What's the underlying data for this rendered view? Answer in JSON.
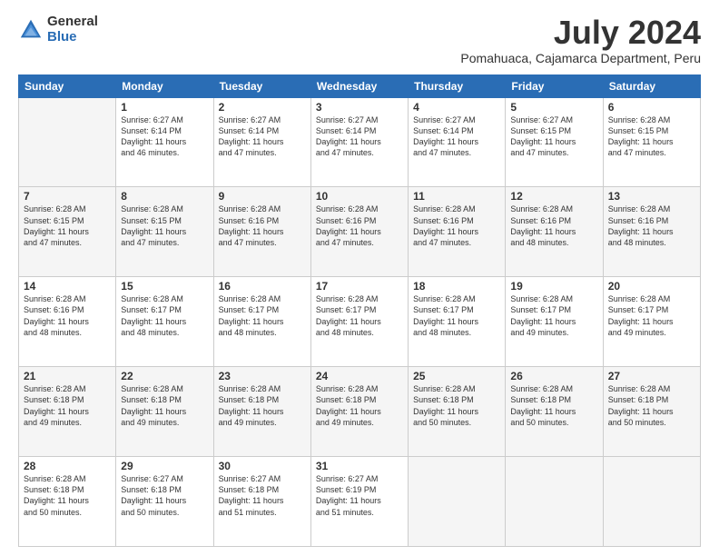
{
  "header": {
    "logo_general": "General",
    "logo_blue": "Blue",
    "month_title": "July 2024",
    "location": "Pomahuaca, Cajamarca Department, Peru"
  },
  "weekdays": [
    "Sunday",
    "Monday",
    "Tuesday",
    "Wednesday",
    "Thursday",
    "Friday",
    "Saturday"
  ],
  "weeks": [
    [
      {
        "day": "",
        "info": ""
      },
      {
        "day": "1",
        "info": "Sunrise: 6:27 AM\nSunset: 6:14 PM\nDaylight: 11 hours\nand 46 minutes."
      },
      {
        "day": "2",
        "info": "Sunrise: 6:27 AM\nSunset: 6:14 PM\nDaylight: 11 hours\nand 47 minutes."
      },
      {
        "day": "3",
        "info": "Sunrise: 6:27 AM\nSunset: 6:14 PM\nDaylight: 11 hours\nand 47 minutes."
      },
      {
        "day": "4",
        "info": "Sunrise: 6:27 AM\nSunset: 6:14 PM\nDaylight: 11 hours\nand 47 minutes."
      },
      {
        "day": "5",
        "info": "Sunrise: 6:27 AM\nSunset: 6:15 PM\nDaylight: 11 hours\nand 47 minutes."
      },
      {
        "day": "6",
        "info": "Sunrise: 6:28 AM\nSunset: 6:15 PM\nDaylight: 11 hours\nand 47 minutes."
      }
    ],
    [
      {
        "day": "7",
        "info": "Sunrise: 6:28 AM\nSunset: 6:15 PM\nDaylight: 11 hours\nand 47 minutes."
      },
      {
        "day": "8",
        "info": "Sunrise: 6:28 AM\nSunset: 6:15 PM\nDaylight: 11 hours\nand 47 minutes."
      },
      {
        "day": "9",
        "info": "Sunrise: 6:28 AM\nSunset: 6:16 PM\nDaylight: 11 hours\nand 47 minutes."
      },
      {
        "day": "10",
        "info": "Sunrise: 6:28 AM\nSunset: 6:16 PM\nDaylight: 11 hours\nand 47 minutes."
      },
      {
        "day": "11",
        "info": "Sunrise: 6:28 AM\nSunset: 6:16 PM\nDaylight: 11 hours\nand 47 minutes."
      },
      {
        "day": "12",
        "info": "Sunrise: 6:28 AM\nSunset: 6:16 PM\nDaylight: 11 hours\nand 48 minutes."
      },
      {
        "day": "13",
        "info": "Sunrise: 6:28 AM\nSunset: 6:16 PM\nDaylight: 11 hours\nand 48 minutes."
      }
    ],
    [
      {
        "day": "14",
        "info": "Sunrise: 6:28 AM\nSunset: 6:16 PM\nDaylight: 11 hours\nand 48 minutes."
      },
      {
        "day": "15",
        "info": "Sunrise: 6:28 AM\nSunset: 6:17 PM\nDaylight: 11 hours\nand 48 minutes."
      },
      {
        "day": "16",
        "info": "Sunrise: 6:28 AM\nSunset: 6:17 PM\nDaylight: 11 hours\nand 48 minutes."
      },
      {
        "day": "17",
        "info": "Sunrise: 6:28 AM\nSunset: 6:17 PM\nDaylight: 11 hours\nand 48 minutes."
      },
      {
        "day": "18",
        "info": "Sunrise: 6:28 AM\nSunset: 6:17 PM\nDaylight: 11 hours\nand 48 minutes."
      },
      {
        "day": "19",
        "info": "Sunrise: 6:28 AM\nSunset: 6:17 PM\nDaylight: 11 hours\nand 49 minutes."
      },
      {
        "day": "20",
        "info": "Sunrise: 6:28 AM\nSunset: 6:17 PM\nDaylight: 11 hours\nand 49 minutes."
      }
    ],
    [
      {
        "day": "21",
        "info": "Sunrise: 6:28 AM\nSunset: 6:18 PM\nDaylight: 11 hours\nand 49 minutes."
      },
      {
        "day": "22",
        "info": "Sunrise: 6:28 AM\nSunset: 6:18 PM\nDaylight: 11 hours\nand 49 minutes."
      },
      {
        "day": "23",
        "info": "Sunrise: 6:28 AM\nSunset: 6:18 PM\nDaylight: 11 hours\nand 49 minutes."
      },
      {
        "day": "24",
        "info": "Sunrise: 6:28 AM\nSunset: 6:18 PM\nDaylight: 11 hours\nand 49 minutes."
      },
      {
        "day": "25",
        "info": "Sunrise: 6:28 AM\nSunset: 6:18 PM\nDaylight: 11 hours\nand 50 minutes."
      },
      {
        "day": "26",
        "info": "Sunrise: 6:28 AM\nSunset: 6:18 PM\nDaylight: 11 hours\nand 50 minutes."
      },
      {
        "day": "27",
        "info": "Sunrise: 6:28 AM\nSunset: 6:18 PM\nDaylight: 11 hours\nand 50 minutes."
      }
    ],
    [
      {
        "day": "28",
        "info": "Sunrise: 6:28 AM\nSunset: 6:18 PM\nDaylight: 11 hours\nand 50 minutes."
      },
      {
        "day": "29",
        "info": "Sunrise: 6:27 AM\nSunset: 6:18 PM\nDaylight: 11 hours\nand 50 minutes."
      },
      {
        "day": "30",
        "info": "Sunrise: 6:27 AM\nSunset: 6:18 PM\nDaylight: 11 hours\nand 51 minutes."
      },
      {
        "day": "31",
        "info": "Sunrise: 6:27 AM\nSunset: 6:19 PM\nDaylight: 11 hours\nand 51 minutes."
      },
      {
        "day": "",
        "info": ""
      },
      {
        "day": "",
        "info": ""
      },
      {
        "day": "",
        "info": ""
      }
    ]
  ]
}
